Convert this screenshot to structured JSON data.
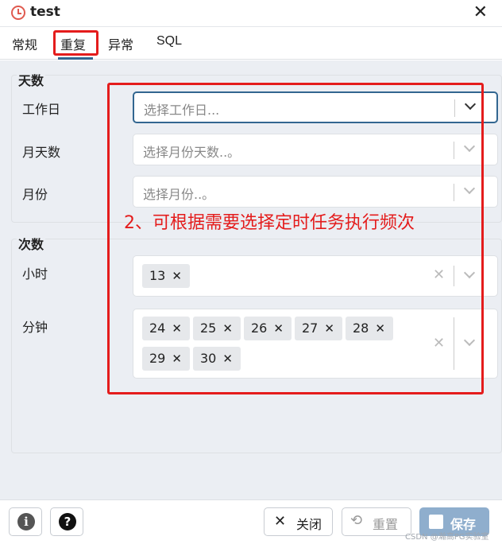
{
  "window": {
    "title": "test"
  },
  "tabs": [
    {
      "label": "常规"
    },
    {
      "label": "重复"
    },
    {
      "label": "异常"
    },
    {
      "label": "SQL"
    }
  ],
  "days_section": {
    "legend": "天数",
    "weekday": {
      "label": "工作日",
      "placeholder": "选择工作日..."
    },
    "monthdays": {
      "label": "月天数",
      "placeholder": "选择月份天数..。"
    },
    "months": {
      "label": "月份",
      "placeholder": "选择月份..。"
    }
  },
  "times_section": {
    "legend": "次数",
    "hours": {
      "label": "小时",
      "values": [
        "13"
      ]
    },
    "minutes": {
      "label": "分钟",
      "values": [
        "24",
        "25",
        "26",
        "27",
        "28",
        "29",
        "30"
      ]
    }
  },
  "annotation": "2、可根据需要选择定时任务执行频次",
  "footer": {
    "info_symbol": "i",
    "help_symbol": "?",
    "close_label": "关闭",
    "reset_label": "重置",
    "save_label": "保存"
  },
  "watermark": "CSDN @瀚高PG实验室",
  "colors": {
    "accent": "#326690",
    "annotation_red": "#e41c1c",
    "save_bg": "#8faecd"
  }
}
